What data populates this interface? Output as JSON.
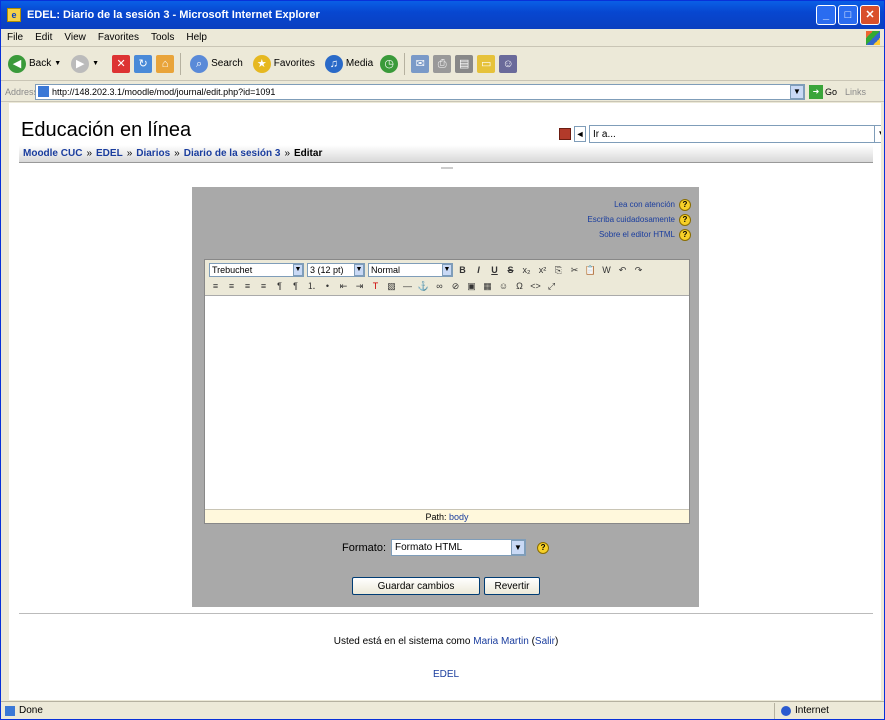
{
  "window": {
    "title": "EDEL: Diario de la sesión 3 - Microsoft Internet Explorer"
  },
  "menu": [
    "File",
    "Edit",
    "View",
    "Favorites",
    "Tools",
    "Help"
  ],
  "toolbar": {
    "back": "Back",
    "search": "Search",
    "favorites": "Favorites",
    "media": "Media"
  },
  "address": {
    "label": "Address",
    "url": "http://148.202.3.1/moodle/mod/journal/edit.php?id=1091",
    "go": "Go",
    "links": "Links"
  },
  "page": {
    "site_title": "Educación en línea",
    "jump_placeholder": "Ir a...",
    "breadcrumb": [
      "Moodle CUC",
      "EDEL",
      "Diarios",
      "Diario de la sesión 3"
    ],
    "breadcrumb_current": "Editar",
    "breadcrumb_sep": "»"
  },
  "help": {
    "read": "Lea con atención",
    "write": "Escriba cuidadosamente",
    "html_editor": "Sobre el editor HTML"
  },
  "editor": {
    "font": "Trebuchet",
    "size": "3 (12 pt)",
    "style": "Normal",
    "path_label": "Path:",
    "path_value": "body"
  },
  "form": {
    "format_label": "Formato:",
    "format_value": "Formato HTML",
    "save_label": "Guardar cambios",
    "revert_label": "Revertir"
  },
  "footer": {
    "login_prefix": "Usted está en el sistema como",
    "user_name": "Maria Martin",
    "logout": "Salir",
    "home_link": "EDEL"
  },
  "status": {
    "text": "Done",
    "zone": "Internet"
  }
}
